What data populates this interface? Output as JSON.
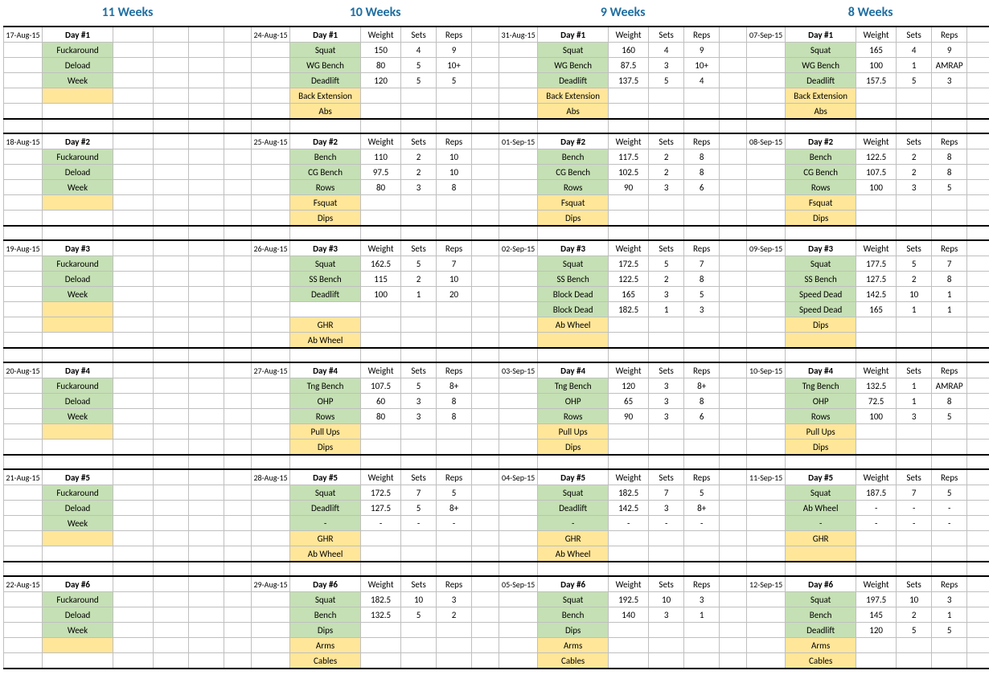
{
  "weeks": [
    {
      "title": "11 Weeks",
      "hasNumbers": false,
      "deload": [
        "Fuckaround",
        "Deload",
        "Week"
      ],
      "days": [
        {
          "date": "17-Aug-15",
          "day": "Day #1"
        },
        {
          "date": "18-Aug-15",
          "day": "Day #2"
        },
        {
          "date": "19-Aug-15",
          "day": "Day #3"
        },
        {
          "date": "20-Aug-15",
          "day": "Day #4"
        },
        {
          "date": "21-Aug-15",
          "day": "Day #5"
        },
        {
          "date": "22-Aug-15",
          "day": "Day #6"
        }
      ]
    },
    {
      "title": "10 Weeks",
      "hasNumbers": true,
      "days": [
        {
          "date": "24-Aug-15",
          "day": "Day #1",
          "lifts": [
            {
              "n": "Squat",
              "w": "150",
              "s": "4",
              "r": "9"
            },
            {
              "n": "WG Bench",
              "w": "80",
              "s": "5",
              "r": "10+"
            },
            {
              "n": "Deadlift",
              "w": "120",
              "s": "5",
              "r": "5"
            }
          ],
          "acc": [
            "Back Extension",
            "Abs"
          ]
        },
        {
          "date": "25-Aug-15",
          "day": "Day #2",
          "lifts": [
            {
              "n": "Bench",
              "w": "110",
              "s": "2",
              "r": "10"
            },
            {
              "n": "CG Bench",
              "w": "97.5",
              "s": "2",
              "r": "10"
            },
            {
              "n": "Rows",
              "w": "80",
              "s": "3",
              "r": "8"
            }
          ],
          "acc": [
            "Fsquat",
            "Dips"
          ]
        },
        {
          "date": "26-Aug-15",
          "day": "Day #3",
          "lifts": [
            {
              "n": "Squat",
              "w": "162.5",
              "s": "5",
              "r": "7"
            },
            {
              "n": "SS Bench",
              "w": "115",
              "s": "2",
              "r": "10"
            },
            {
              "n": "Deadlift",
              "w": "100",
              "s": "1",
              "r": "20"
            }
          ],
          "acc": [
            "GHR",
            "Ab Wheel"
          ]
        },
        {
          "date": "27-Aug-15",
          "day": "Day #4",
          "lifts": [
            {
              "n": "Tng Bench",
              "w": "107.5",
              "s": "5",
              "r": "8+"
            },
            {
              "n": "OHP",
              "w": "60",
              "s": "3",
              "r": "8"
            },
            {
              "n": "Rows",
              "w": "80",
              "s": "3",
              "r": "8"
            }
          ],
          "acc": [
            "Pull Ups",
            "Dips"
          ]
        },
        {
          "date": "28-Aug-15",
          "day": "Day #5",
          "lifts": [
            {
              "n": "Squat",
              "w": "172.5",
              "s": "7",
              "r": "5"
            },
            {
              "n": "Deadlift",
              "w": "127.5",
              "s": "5",
              "r": "8+"
            },
            {
              "n": "-",
              "w": "-",
              "s": "-",
              "r": "-"
            }
          ],
          "acc": [
            "GHR",
            "Ab Wheel"
          ]
        },
        {
          "date": "29-Aug-15",
          "day": "Day #6",
          "lifts": [
            {
              "n": "Squat",
              "w": "182.5",
              "s": "10",
              "r": "3"
            },
            {
              "n": "Bench",
              "w": "132.5",
              "s": "5",
              "r": "2"
            },
            {
              "n": "Dips",
              "w": "",
              "s": "",
              "r": ""
            }
          ],
          "acc": [
            "Arms",
            "Cables"
          ]
        }
      ]
    },
    {
      "title": "9 Weeks",
      "hasNumbers": true,
      "days": [
        {
          "date": "31-Aug-15",
          "day": "Day #1",
          "lifts": [
            {
              "n": "Squat",
              "w": "160",
              "s": "4",
              "r": "9"
            },
            {
              "n": "WG Bench",
              "w": "87.5",
              "s": "3",
              "r": "10+"
            },
            {
              "n": "Deadlift",
              "w": "137.5",
              "s": "5",
              "r": "4"
            }
          ],
          "acc": [
            "Back Extension",
            "Abs"
          ]
        },
        {
          "date": "01-Sep-15",
          "day": "Day #2",
          "lifts": [
            {
              "n": "Bench",
              "w": "117.5",
              "s": "2",
              "r": "8"
            },
            {
              "n": "CG Bench",
              "w": "102.5",
              "s": "2",
              "r": "8"
            },
            {
              "n": "Rows",
              "w": "90",
              "s": "3",
              "r": "6"
            }
          ],
          "acc": [
            "Fsquat",
            "Dips"
          ]
        },
        {
          "date": "02-Sep-15",
          "day": "Day #3",
          "lifts": [
            {
              "n": "Squat",
              "w": "172.5",
              "s": "5",
              "r": "7"
            },
            {
              "n": "SS Bench",
              "w": "122.5",
              "s": "2",
              "r": "8"
            },
            {
              "n": "Block Dead",
              "w": "165",
              "s": "3",
              "r": "5"
            },
            {
              "n": "Block Dead",
              "w": "182.5",
              "s": "1",
              "r": "3"
            }
          ],
          "acc": [
            "Ab Wheel",
            ""
          ]
        },
        {
          "date": "03-Sep-15",
          "day": "Day #4",
          "lifts": [
            {
              "n": "Tng Bench",
              "w": "120",
              "s": "3",
              "r": "8+"
            },
            {
              "n": "OHP",
              "w": "65",
              "s": "3",
              "r": "8"
            },
            {
              "n": "Rows",
              "w": "90",
              "s": "3",
              "r": "6"
            }
          ],
          "acc": [
            "Pull Ups",
            "Dips"
          ]
        },
        {
          "date": "04-Sep-15",
          "day": "Day #5",
          "lifts": [
            {
              "n": "Squat",
              "w": "182.5",
              "s": "7",
              "r": "5"
            },
            {
              "n": "Deadlift",
              "w": "142.5",
              "s": "3",
              "r": "8+"
            },
            {
              "n": "-",
              "w": "-",
              "s": "-",
              "r": "-"
            }
          ],
          "acc": [
            "GHR",
            "Ab Wheel"
          ]
        },
        {
          "date": "05-Sep-15",
          "day": "Day #6",
          "lifts": [
            {
              "n": "Squat",
              "w": "192.5",
              "s": "10",
              "r": "3"
            },
            {
              "n": "Bench",
              "w": "140",
              "s": "3",
              "r": "1"
            },
            {
              "n": "Dips",
              "w": "",
              "s": "",
              "r": ""
            }
          ],
          "acc": [
            "Arms",
            "Cables"
          ]
        }
      ]
    },
    {
      "title": "8 Weeks",
      "hasNumbers": true,
      "days": [
        {
          "date": "07-Sep-15",
          "day": "Day #1",
          "lifts": [
            {
              "n": "Squat",
              "w": "165",
              "s": "4",
              "r": "9"
            },
            {
              "n": "WG Bench",
              "w": "100",
              "s": "1",
              "r": "AMRAP"
            },
            {
              "n": "Deadlift",
              "w": "157.5",
              "s": "5",
              "r": "3"
            }
          ],
          "acc": [
            "Back Extension",
            "Abs"
          ]
        },
        {
          "date": "08-Sep-15",
          "day": "Day #2",
          "lifts": [
            {
              "n": "Bench",
              "w": "122.5",
              "s": "2",
              "r": "8"
            },
            {
              "n": "CG Bench",
              "w": "107.5",
              "s": "2",
              "r": "8"
            },
            {
              "n": "Rows",
              "w": "100",
              "s": "3",
              "r": "5"
            }
          ],
          "acc": [
            "Fsquat",
            "Dips"
          ]
        },
        {
          "date": "09-Sep-15",
          "day": "Day #3",
          "lifts": [
            {
              "n": "Squat",
              "w": "177.5",
              "s": "5",
              "r": "7"
            },
            {
              "n": "SS Bench",
              "w": "127.5",
              "s": "2",
              "r": "8"
            },
            {
              "n": "Speed Dead",
              "w": "142.5",
              "s": "10",
              "r": "1"
            },
            {
              "n": "Speed Dead",
              "w": "165",
              "s": "1",
              "r": "1"
            }
          ],
          "acc": [
            "Dips",
            ""
          ]
        },
        {
          "date": "10-Sep-15",
          "day": "Day #4",
          "lifts": [
            {
              "n": "Tng Bench",
              "w": "132.5",
              "s": "1",
              "r": "AMRAP"
            },
            {
              "n": "OHP",
              "w": "72.5",
              "s": "1",
              "r": "8"
            },
            {
              "n": "Rows",
              "w": "100",
              "s": "3",
              "r": "5"
            }
          ],
          "acc": [
            "Pull Ups",
            "Dips"
          ]
        },
        {
          "date": "11-Sep-15",
          "day": "Day #5",
          "lifts": [
            {
              "n": "Squat",
              "w": "187.5",
              "s": "7",
              "r": "5"
            },
            {
              "n": "Ab Wheel",
              "w": "-",
              "s": "-",
              "r": "-"
            },
            {
              "n": "-",
              "w": "-",
              "s": "-",
              "r": "-"
            }
          ],
          "acc": [
            "GHR",
            ""
          ]
        },
        {
          "date": "12-Sep-15",
          "day": "Day #6",
          "lifts": [
            {
              "n": "Squat",
              "w": "197.5",
              "s": "10",
              "r": "3"
            },
            {
              "n": "Bench",
              "w": "145",
              "s": "2",
              "r": "1"
            },
            {
              "n": "Deadlift",
              "w": "120",
              "s": "5",
              "r": "5"
            }
          ],
          "acc": [
            "Arms",
            "Cables"
          ]
        }
      ]
    }
  ],
  "colHdr": {
    "w": "Weight",
    "s": "Sets",
    "r": "Reps"
  }
}
